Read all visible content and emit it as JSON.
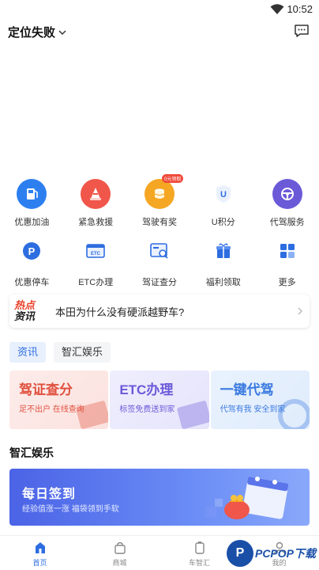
{
  "status": {
    "time": "10:52"
  },
  "header": {
    "location": "定位失败"
  },
  "grid_row1": [
    {
      "label": "优惠加油",
      "icon": "fuel-icon",
      "color": "#2d7ff0"
    },
    {
      "label": "紧急救援",
      "icon": "rescue-cone-icon",
      "color": "#f0564a"
    },
    {
      "label": "驾驶有奖",
      "icon": "coin-stack-icon",
      "color": "#f5a623",
      "badge": "0元领取"
    },
    {
      "label": "U积分",
      "icon": "u-shield-icon",
      "color": "#2d6de0"
    },
    {
      "label": "代驾服务",
      "icon": "steering-wheel-icon",
      "color": "#6a5ad8"
    }
  ],
  "grid_row2": [
    {
      "label": "优惠停车",
      "icon": "parking-icon",
      "color": "#2d6de0"
    },
    {
      "label": "ETC办理",
      "icon": "etc-card-icon",
      "color": "#2d6de0"
    },
    {
      "label": "驾证查分",
      "icon": "license-search-icon",
      "color": "#2d6de0"
    },
    {
      "label": "福利领取",
      "icon": "gift-icon",
      "color": "#2d6de0"
    },
    {
      "label": "更多",
      "icon": "grid-more-icon",
      "color": "#2d6de0"
    }
  ],
  "hot": {
    "logo_line1": "热点",
    "logo_line2": "资讯",
    "text": "本田为什么没有硬派越野车?"
  },
  "tabs": [
    {
      "label": "资讯"
    },
    {
      "label": "智汇娱乐"
    }
  ],
  "cards": [
    {
      "title": "驾证查分",
      "subtitle": "足不出户 在线查询"
    },
    {
      "title": "ETC办理",
      "subtitle": "标签免费送到家"
    },
    {
      "title": "一键代驾",
      "subtitle": "代驾有我 安全到家"
    }
  ],
  "section": {
    "title": "智汇娱乐"
  },
  "sign": {
    "title": "每日签到",
    "subtitle": "经验值涨一涨 福袋领到手软"
  },
  "tabbar": [
    {
      "label": "首页"
    },
    {
      "label": "商城"
    },
    {
      "label": "车智汇"
    },
    {
      "label": "我的"
    }
  ],
  "watermark": {
    "letter": "P",
    "text": "PCPOP下载"
  },
  "colors": {
    "accent": "#2d6de0",
    "red": "#e0503e",
    "purple": "#6a5ad8"
  }
}
